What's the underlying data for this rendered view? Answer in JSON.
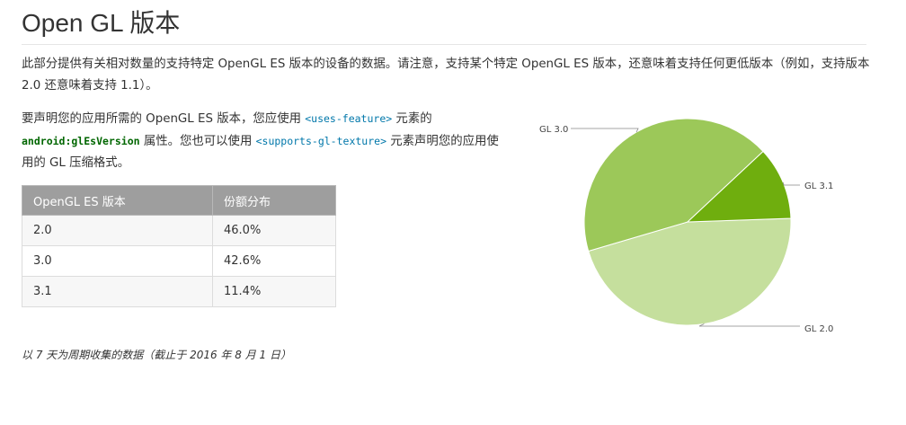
{
  "page": {
    "title": "Open GL 版本",
    "intro": {
      "p1": "此部分提供有关相对数量的支持特定 ",
      "highlight": "OpenGL ES",
      "p2": " 版本的设备的数据。请注意，支持某个特定 OpenGL ES 版本，还意味着支持任何更低版本（例如，支持版本 2.0 还意味着支持 1.1）。"
    },
    "declare": {
      "t1": "要声明您的应用所需的 OpenGL ES 版本，您应使用 ",
      "tag1": "<uses-feature>",
      "t2": " 元素的 ",
      "attr": "android:glEsVersion",
      "t3": " 属性。您也可以使用 ",
      "tag2": "<supports-gl-texture>",
      "t4": " 元素声明您的应用使用的 GL 压缩格式。"
    },
    "footnote": "以 7 天为周期收集的数据（截止于 2016 年 8 月 1 日）"
  },
  "table": {
    "headers": [
      "OpenGL ES 版本",
      "份额分布"
    ],
    "rows": [
      {
        "version": "2.0",
        "share": "46.0%"
      },
      {
        "version": "3.0",
        "share": "42.6%"
      },
      {
        "version": "3.1",
        "share": "11.4%"
      }
    ]
  },
  "chart_data": {
    "type": "pie",
    "categories": [
      "GL 2.0",
      "GL 3.0",
      "GL 3.1"
    ],
    "values": [
      46.0,
      42.6,
      11.4
    ],
    "colors": [
      "#c5df9d",
      "#9cc859",
      "#6fae0e"
    ],
    "labels": [
      "GL 2.0",
      "GL 3.0",
      "GL 3.1"
    ]
  },
  "colors": {
    "table_header": "#9e9e9e",
    "code_tag": "#0077aa",
    "code_attr": "#006600",
    "text": "#333333"
  }
}
